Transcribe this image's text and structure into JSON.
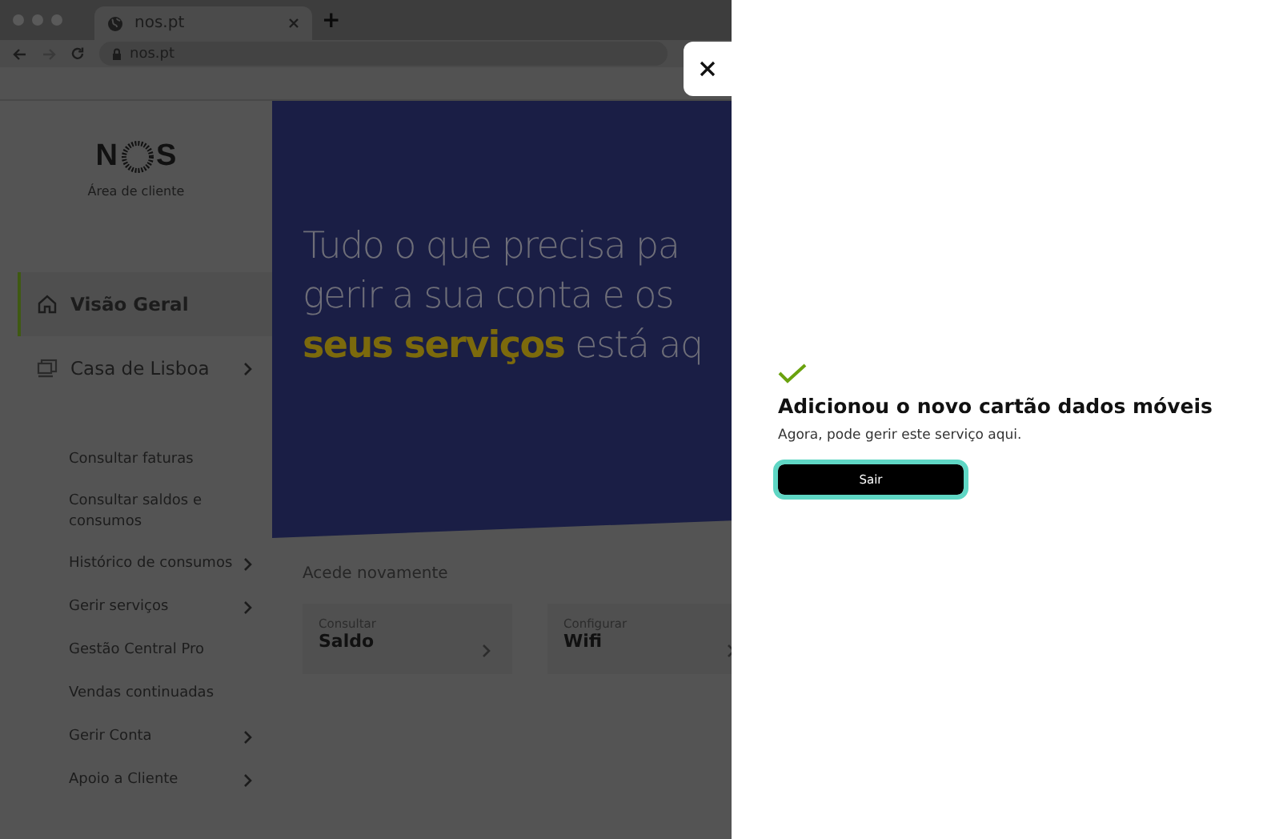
{
  "browser": {
    "tab_title": "nos.pt",
    "new_tab": "+",
    "url": "nos.pt"
  },
  "sidebar": {
    "logo_letters": [
      "N",
      "S"
    ],
    "subtitle": "Área de cliente",
    "items": [
      {
        "label": "Visão Geral",
        "kind": "main",
        "selected": true,
        "expandable": false
      },
      {
        "label": "Casa de Lisboa",
        "kind": "main",
        "selected": false,
        "expandable": true
      },
      {
        "label": "Consultar faturas",
        "kind": "sub",
        "expandable": false
      },
      {
        "label": "Consultar saldos e consumos",
        "kind": "sub",
        "expandable": false
      },
      {
        "label": "Histórico de consumos",
        "kind": "sub",
        "expandable": true
      },
      {
        "label": "Gerir serviços",
        "kind": "sub",
        "expandable": true
      },
      {
        "label": "Gestão Central Pro",
        "kind": "sub",
        "expandable": false
      },
      {
        "label": "Vendas continuadas",
        "kind": "sub",
        "expandable": false
      },
      {
        "label": "Gerir Conta",
        "kind": "sub",
        "expandable": true
      },
      {
        "label": "Apoio a Cliente",
        "kind": "sub",
        "expandable": true
      }
    ]
  },
  "hero": {
    "lines": [
      "Tudo o que precisa pa",
      "gerir a sua conta e os",
      "**seus serviços** está aq"
    ]
  },
  "quick_access": {
    "title": "Acede novamente",
    "cards": [
      {
        "caption": "Consultar",
        "title": "Saldo"
      },
      {
        "caption": "Configurar",
        "title": "Wifi"
      }
    ]
  },
  "panel": {
    "title": "Adicionou o novo cartão dados móveis",
    "message": "Agora, pode gerir este serviço aqui.",
    "button": {
      "label": "Sair",
      "focused": true
    }
  }
}
